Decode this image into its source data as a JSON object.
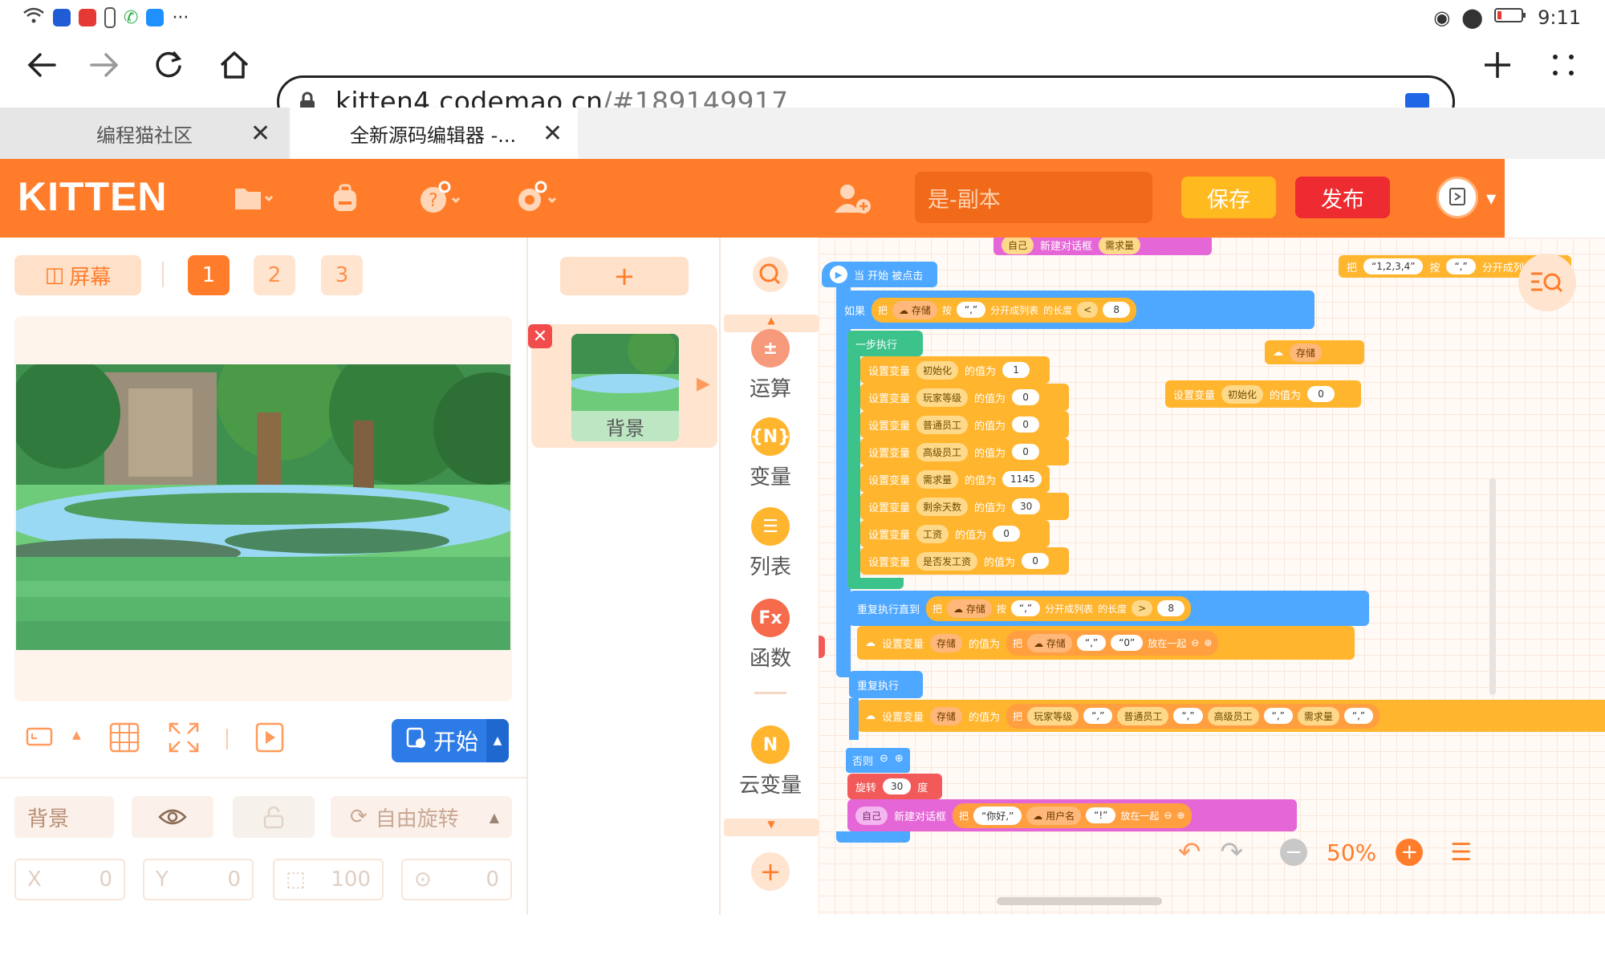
{
  "status_bar": {
    "time": "9:11",
    "more": "···"
  },
  "browser": {
    "url_host": "kitten4.codemao.cn",
    "url_path": "/#189149917",
    "tabs": [
      {
        "label": "编程猫社区"
      },
      {
        "label": "全新源码编辑器 -..."
      }
    ]
  },
  "app": {
    "logo": "KITTEN",
    "project_name": "是-副本",
    "save_label": "保存",
    "publish_label": "发布"
  },
  "stage": {
    "screen_label": "屏幕",
    "pages": [
      "1",
      "2",
      "3"
    ],
    "start_label": "开始"
  },
  "properties": {
    "name": "背景",
    "rotation_label": "自由旋转",
    "x_label": "X",
    "x_value": "0",
    "y_label": "Y",
    "y_value": "0",
    "scale_value": "100",
    "direction_value": "0"
  },
  "sprites": {
    "add_label": "+",
    "items": [
      {
        "label": "背景"
      }
    ]
  },
  "categories": [
    {
      "label": "运算",
      "icon": "arith-icon"
    },
    {
      "label": "变量",
      "icon": "{N}"
    },
    {
      "label": "列表",
      "icon": "list-icon"
    },
    {
      "label": "函数",
      "icon": "Fx"
    },
    {
      "label": "云变量",
      "icon": "cloud-N"
    }
  ],
  "blocks": {
    "top_dialog": {
      "target": "自己",
      "text": "新建对话框",
      "value": "需求量"
    },
    "when_start": "当 开始 被点击",
    "if_label": "如果",
    "split_of": "把",
    "storage": "存储",
    "by": "按",
    "comma": "“,”",
    "split_list": "分开成列表",
    "length": "的长度",
    "lt": "<",
    "gt": ">",
    "eight": "8",
    "step_exec": "一步执行",
    "set_var": "设置变量",
    "value_of": "的值为",
    "set_rows": [
      {
        "var": "初始化",
        "value": "1"
      },
      {
        "var": "玩家等级",
        "value": "0"
      },
      {
        "var": "普通员工",
        "value": "0"
      },
      {
        "var": "高级员工",
        "value": "0"
      },
      {
        "var": "需求量",
        "value": "1145"
      },
      {
        "var": "剩余天数",
        "value": "30"
      },
      {
        "var": "工资",
        "value": "0"
      },
      {
        "var": "是否发工资",
        "value": "0"
      }
    ],
    "repeat_until": "重复执行直到",
    "join_label": "放在一起",
    "zero_str": "“0”",
    "repeat": "重复执行",
    "repeat_row": [
      "玩家等级",
      "普通员工",
      "高级员工",
      "需求量"
    ],
    "else_label": "否则",
    "rotate": "旋转",
    "rotate_value": "30",
    "degree": "度",
    "dialog_target": "自己",
    "new_dialog": "新建对话框",
    "hello": "“你好,”",
    "username": "用户名",
    "exclaim": "“!”",
    "floating_split": "“1,2,3,4”",
    "floating_split_label": "分开成列",
    "floating_storage": "存储",
    "floating_set_var": "初始化",
    "floating_set_value": "0"
  },
  "zoom": {
    "value": "50%"
  },
  "colors": {
    "brand": "#ff7d2a",
    "save": "#ffba1f",
    "publish": "#ee2b30",
    "start": "#2d7be6"
  }
}
